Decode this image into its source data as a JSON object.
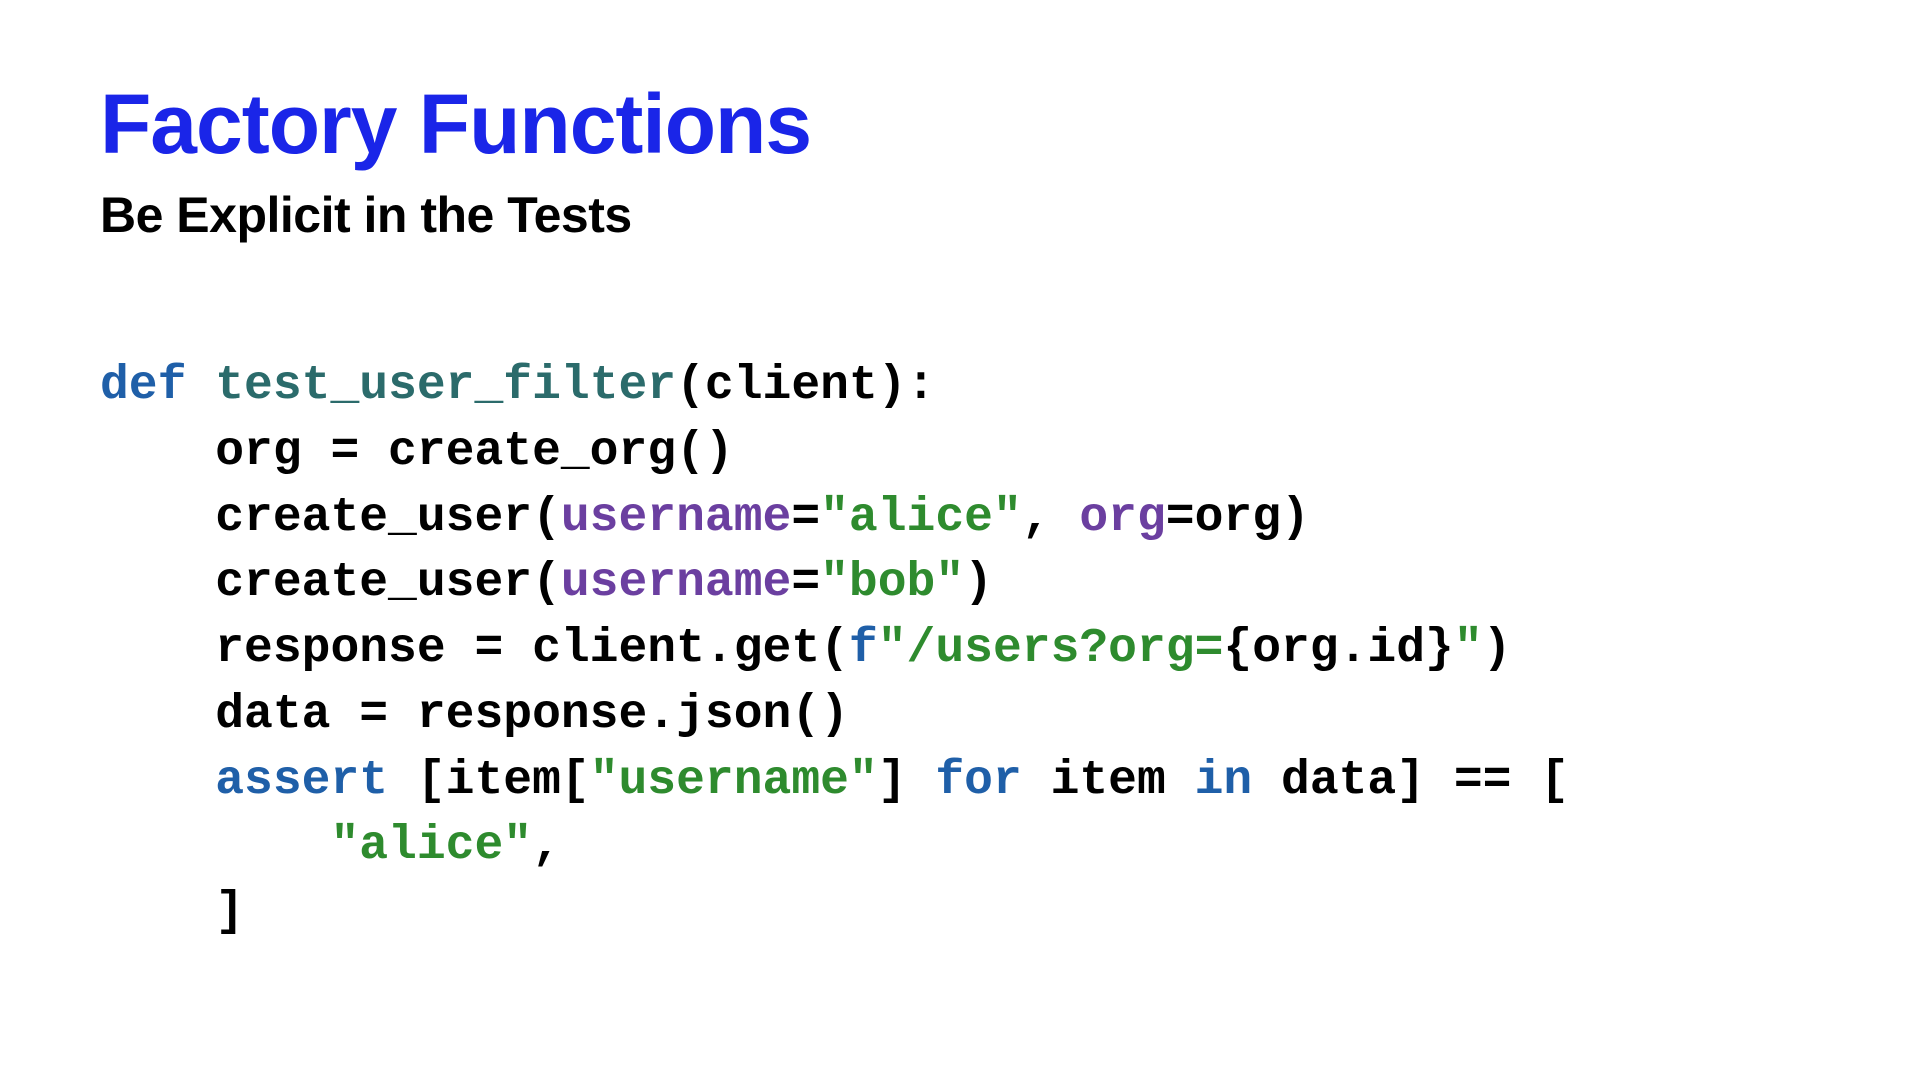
{
  "title": "Factory Functions",
  "subtitle": "Be Explicit in the Tests",
  "code": {
    "kw_def": "def",
    "fn_test": "test_user_filter",
    "sig_rest": "(client):",
    "l2_a": "    org = create_org()",
    "l3_a": "    create_user(",
    "l3_param1": "username",
    "l3_eq1": "=",
    "l3_str1": "\"alice\"",
    "l3_mid": ", ",
    "l3_param2": "org",
    "l3_eq2": "=org)",
    "l4_a": "    create_user(",
    "l4_param1": "username",
    "l4_eq1": "=",
    "l4_str1": "\"bob\"",
    "l4_end": ")",
    "l5_a": "    response = client.get(",
    "l5_f": "f",
    "l5_str_open": "\"/users?org=",
    "l5_interp": "{org.id}",
    "l5_str_close": "\"",
    "l5_end": ")",
    "l6": "    data = response.json()",
    "l7_indent": "    ",
    "l7_assert": "assert",
    "l7_a": " [item[",
    "l7_str": "\"username\"",
    "l7_b": "] ",
    "l7_for": "for",
    "l7_c": " item ",
    "l7_in": "in",
    "l7_d": " data] == [",
    "l8_a": "        ",
    "l8_str": "\"alice\"",
    "l8_b": ",",
    "l9": "    ]"
  }
}
